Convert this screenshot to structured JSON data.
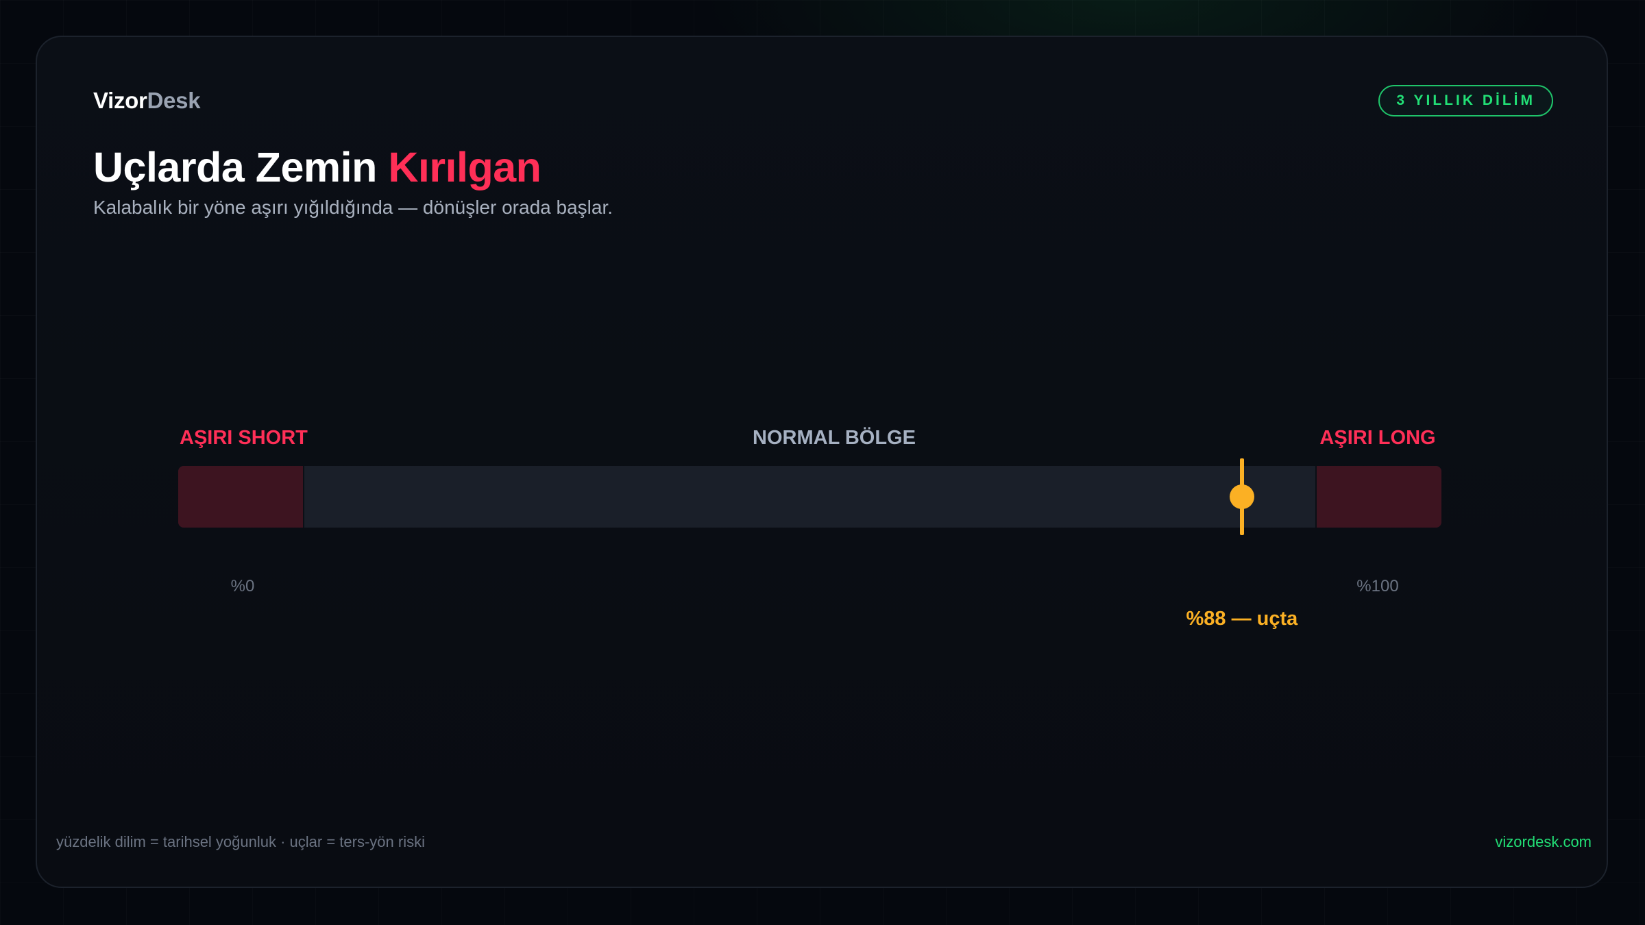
{
  "brand": {
    "name_part1": "Vizor",
    "name_part2": "Desk"
  },
  "badge": {
    "label": "3 YILLIK DİLİM",
    "color": "#22e076"
  },
  "header": {
    "title_main": "Uçlarda Zemin ",
    "title_accent": "Kırılgan",
    "subtitle": "Kalabalık bir yöne aşırı yığıldığında — dönüşler orada başlar."
  },
  "gauge": {
    "zone_left_label": "AŞIRI SHORT",
    "zone_mid_label": "NORMAL BÖLGE",
    "zone_right_label": "AŞIRI LONG",
    "tick_min_label": "%0",
    "tick_max_label": "%100",
    "value_percent": 88,
    "readout": "%88 — uçta",
    "colors": {
      "extreme": "#3d1420",
      "normal": "#1a1f29",
      "marker": "#fbb024",
      "extreme_label": "#ff2f57"
    }
  },
  "footer": {
    "legend": "yüzdelik dilim = tarihsel yoğunluk · uçlar = ters-yön riski",
    "site": "vizordesk.com"
  }
}
